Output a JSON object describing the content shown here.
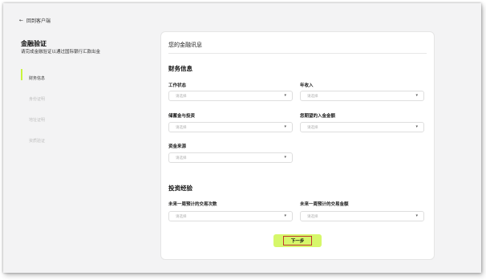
{
  "header": {
    "back_icon": "←",
    "back_label": "回到客户端"
  },
  "left": {
    "title": "金融验证",
    "subtitle": "请完成金融验证以通过国际银行汇款出金",
    "steps": [
      {
        "label": "财务信息"
      },
      {
        "label": "身份证明"
      },
      {
        "label": "地址证明"
      },
      {
        "label": "资质验证"
      }
    ]
  },
  "card": {
    "title": "您的金融讯息",
    "finance_section": "财务信息",
    "experience_section": "投资经验",
    "fields": {
      "employment": {
        "label": "工作状态",
        "placeholder": "请选择"
      },
      "income": {
        "label": "年收入",
        "placeholder": "请选择"
      },
      "savings": {
        "label": "储蓄金与投资",
        "placeholder": "请选择"
      },
      "deposit": {
        "label": "您期望的入金金额",
        "placeholder": "请选择"
      },
      "fund_source": {
        "label": "资金来源",
        "placeholder": "请选择"
      },
      "trade_count": {
        "label": "未来一周预计的交易次数",
        "placeholder": "请选择"
      },
      "trade_amount": {
        "label": "未来一周预计的交易金额",
        "placeholder": "请选择"
      }
    },
    "chevron": "▾",
    "next_label": "下一步"
  }
}
